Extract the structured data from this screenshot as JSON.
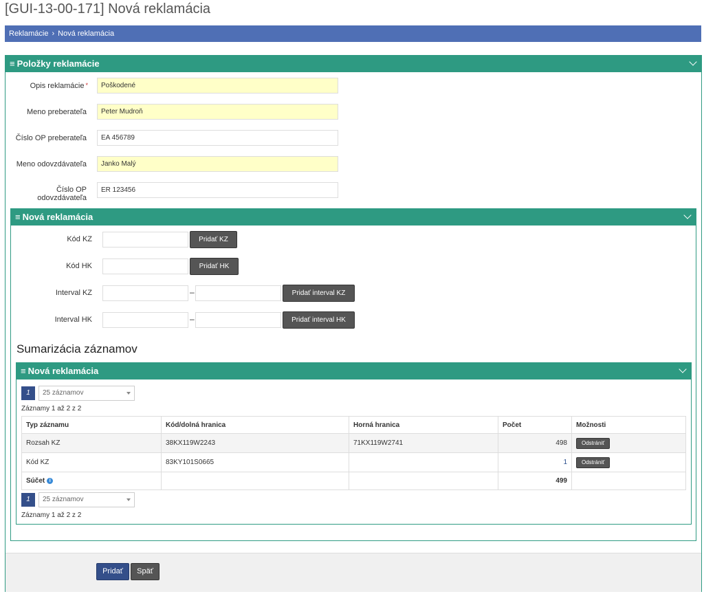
{
  "page_title": "[GUI-13-00-171] Nová reklamácia",
  "breadcrumb": {
    "items": [
      "Reklamácie",
      "Nová reklamácia"
    ]
  },
  "panel_polozky": {
    "title": "Položky reklamácie",
    "fields": [
      {
        "label": "Opis reklamácie",
        "value": "Poškodené",
        "required": "*"
      },
      {
        "label": "Meno preberateľa",
        "value": "Peter Mudroň"
      },
      {
        "label": "Číslo OP preberateľa",
        "value": "EA 456789"
      },
      {
        "label": "Meno odovzdávateľa",
        "value": "Janko Malý"
      },
      {
        "label": "Číslo OP odovzdávateľa",
        "value": "ER 123456"
      }
    ]
  },
  "panel_nova": {
    "title": "Nová reklamácia",
    "kod_kz_label": "Kód KZ",
    "kod_hk_label": "Kód HK",
    "interval_kz_label": "Interval KZ",
    "interval_hk_label": "Interval HK",
    "dash": "–",
    "btn_pridat_kz": "Pridať KZ",
    "btn_pridat_hk": "Pridať HK",
    "btn_pridat_interval_kz": "Pridať interval KZ",
    "btn_pridat_interval_hk": "Pridať interval HK"
  },
  "summary": {
    "heading": "Sumarizácia záznamov",
    "panel_title": "Nová reklamácia",
    "page": "1",
    "page_size": "25 záznamov",
    "records_info": "Záznamy 1 až 2 z 2",
    "columns": [
      "Typ záznamu",
      "Kód/dolná hranica",
      "Horná hranica",
      "Počet",
      "Možnosti"
    ],
    "rows": [
      {
        "typ": "Rozsah KZ",
        "kod": "38KX119W2243",
        "horna": "71KX119W2741",
        "pocet": "498",
        "action": "Odstrániť"
      },
      {
        "typ": "Kód KZ",
        "kod": "83KY101S0665",
        "horna": "",
        "pocet": "1",
        "action": "Odstrániť"
      }
    ],
    "sum_label": "Súčet",
    "sum_value": "499"
  },
  "footer": {
    "btn_pridat": "Pridať",
    "btn_spat": "Späť"
  },
  "colors": {
    "teal": "#2e9a82",
    "blue_bar": "#4f6fb5",
    "dark_blue": "#344f8a",
    "required_yellow": "#ffffc8"
  }
}
